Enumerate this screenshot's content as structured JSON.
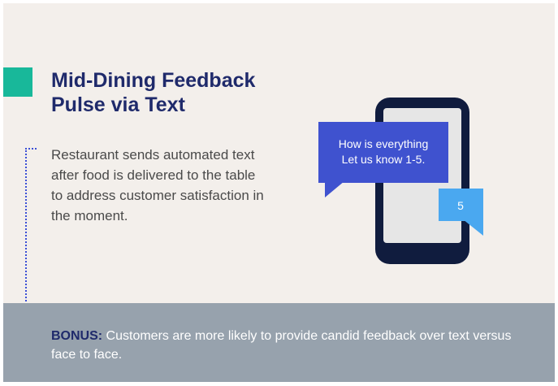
{
  "title": "Mid-Dining Feedback Pulse via Text",
  "description": "Restaurant sends automated text after food is delivered to the table to address customer satisfaction in the moment.",
  "bonus": {
    "label": "BONUS:",
    "text": " Customers are more likely to provide candid feedback over text versus face to face."
  },
  "phone": {
    "message_line1": "How is everything",
    "message_line2": "Let us know 1-5.",
    "reply": "5"
  },
  "colors": {
    "background": "#f3efeb",
    "accent": "#18b89a",
    "title": "#1f2a6b",
    "bonus_band": "#97a2ad",
    "phone": "#101c3e",
    "message_bubble": "#3f52cf",
    "reply_bubble": "#4aa8f0"
  }
}
